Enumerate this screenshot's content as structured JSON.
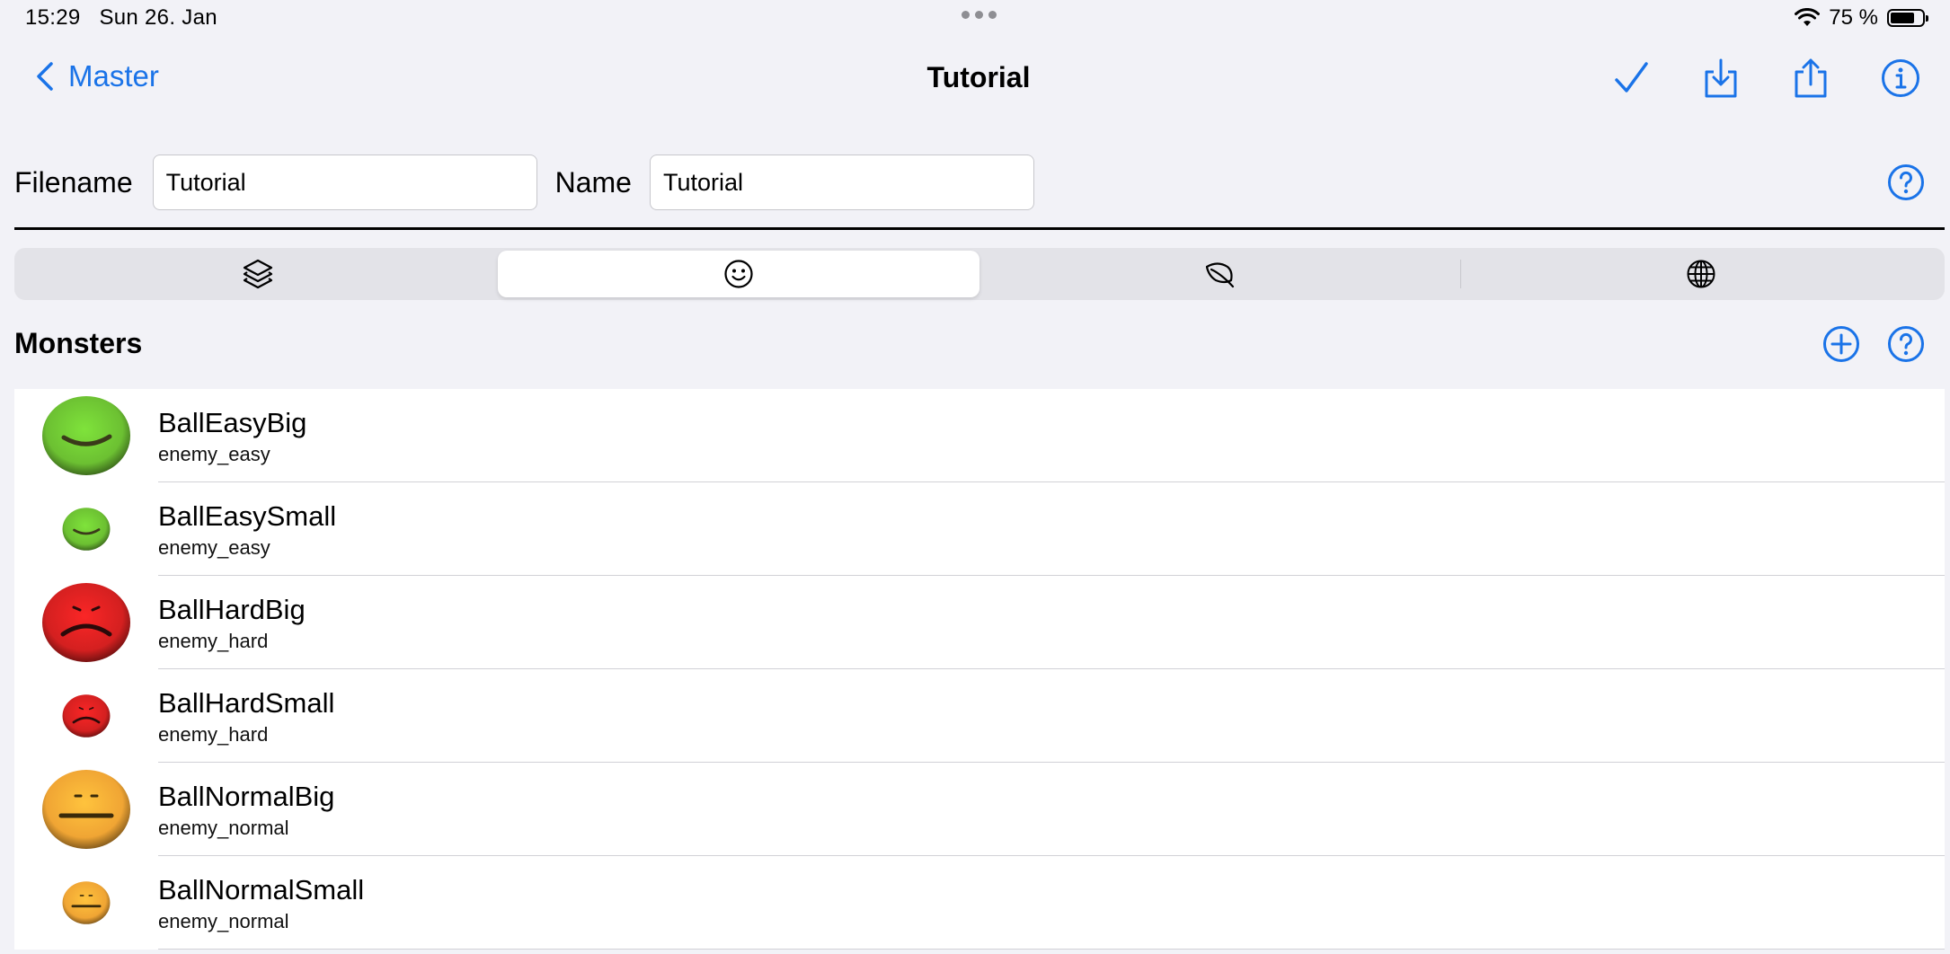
{
  "status_bar": {
    "time": "15:29",
    "date": "Sun 26. Jan",
    "battery_percent": "75 %",
    "battery_level": 0.75,
    "wifi_icon": "wifi-icon"
  },
  "nav": {
    "back_label": "Master",
    "title": "Tutorial",
    "icons": [
      "checkmark-icon",
      "download-icon",
      "share-icon",
      "info-icon"
    ]
  },
  "form": {
    "filename_label": "Filename",
    "filename_value": "Tutorial",
    "name_label": "Name",
    "name_value": "Tutorial"
  },
  "tabs": [
    {
      "icon": "layers-icon",
      "selected": false
    },
    {
      "icon": "smiley-icon",
      "selected": true
    },
    {
      "icon": "leaf-icon",
      "selected": false
    },
    {
      "icon": "globe-icon",
      "selected": false
    }
  ],
  "section": {
    "title": "Monsters",
    "actions": [
      "add-icon",
      "help-icon"
    ]
  },
  "monsters": [
    {
      "name": "BallEasyBig",
      "type": "enemy_easy",
      "color": "#6cc032",
      "mood": "happy",
      "size": "big"
    },
    {
      "name": "BallEasySmall",
      "type": "enemy_easy",
      "color": "#6cc032",
      "mood": "happy",
      "size": "small"
    },
    {
      "name": "BallHardBig",
      "type": "enemy_hard",
      "color": "#d42020",
      "mood": "sad",
      "size": "big"
    },
    {
      "name": "BallHardSmall",
      "type": "enemy_hard",
      "color": "#d42020",
      "mood": "sad",
      "size": "small"
    },
    {
      "name": "BallNormalBig",
      "type": "enemy_normal",
      "color": "#f0a534",
      "mood": "neutral",
      "size": "big"
    },
    {
      "name": "BallNormalSmall",
      "type": "enemy_normal",
      "color": "#f0a534",
      "mood": "neutral",
      "size": "small"
    }
  ],
  "colors": {
    "accent": "#1a73e8",
    "background": "#f2f2f7"
  }
}
